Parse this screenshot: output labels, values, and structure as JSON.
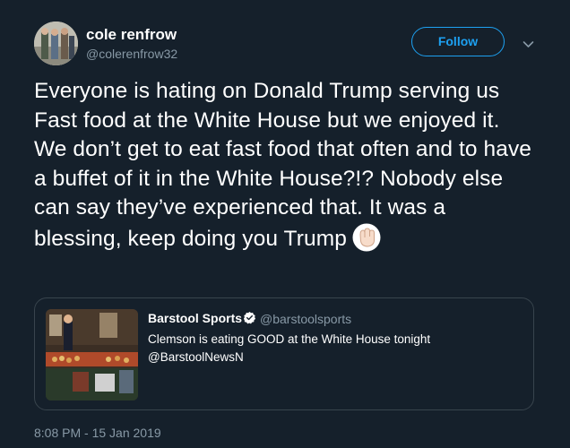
{
  "author": {
    "name": "cole renfrow",
    "handle": "@colerenfrow32"
  },
  "follow_label": "Follow",
  "tweet": {
    "text": "Everyone is hating on Donald Trump serving us Fast food at the White House but we enjoyed it. We don’t get to eat fast food that often and to have a buffet of it in the White House?!? Nobody else can say they’ve experienced that. It was a blessing, keep doing you Trump",
    "emoji": "raised-fist-icon"
  },
  "quoted": {
    "name": "Barstool Sports",
    "handle": "@barstoolsports",
    "text_line1": "Clemson is eating GOOD at the White House tonight",
    "text_line2": "@BarstoolNewsN"
  },
  "timestamp": "8:08 PM - 15 Jan 2019",
  "colors": {
    "background": "#15202b",
    "accent": "#1da1f2",
    "secondary_text": "#8899a6",
    "border": "#38444d"
  }
}
